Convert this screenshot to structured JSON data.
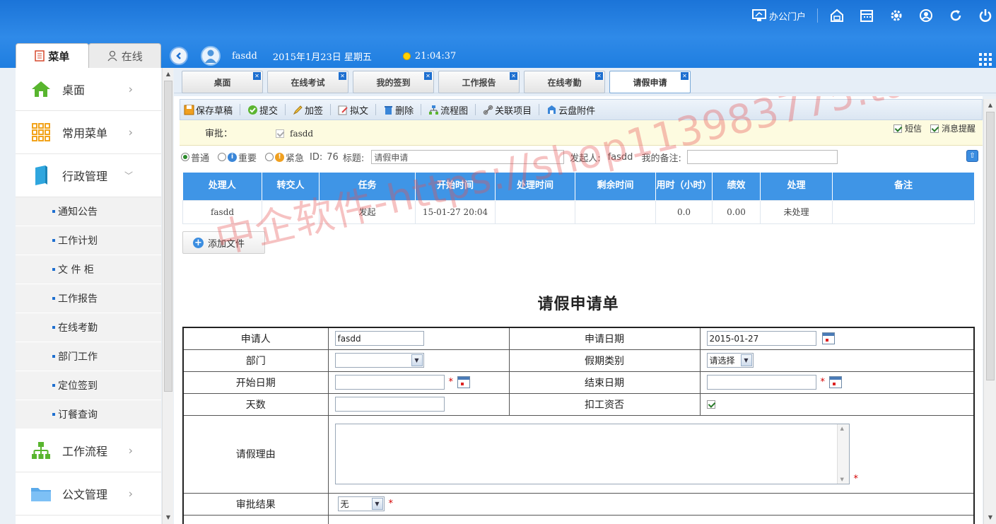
{
  "header": {
    "portal_label": "办公门户",
    "icons": [
      "portal-icon",
      "database-icon",
      "calendar-icon",
      "gear-icon",
      "user-circle-icon",
      "refresh-icon",
      "power-icon"
    ]
  },
  "sidebar_tabs": {
    "menu": "菜单",
    "online": "在线"
  },
  "userbar": {
    "username": "fasdd",
    "date": "2015年1月23日 星期五",
    "time": "21:04:37"
  },
  "sidebar": {
    "items": [
      {
        "label": "桌面",
        "icon": "home-icon"
      },
      {
        "label": "常用菜单",
        "icon": "grid-icon"
      },
      {
        "label": "行政管理",
        "icon": "book-icon"
      }
    ],
    "subitems": [
      "通知公告",
      "工作计划",
      "文 件 柜",
      "工作报告",
      "在线考勤",
      "部门工作",
      "定位签到",
      "订餐查询"
    ],
    "items_after": [
      {
        "label": "工作流程",
        "icon": "flow-icon"
      },
      {
        "label": "公文管理",
        "icon": "folder-icon"
      }
    ]
  },
  "tabs": [
    "桌面",
    "在线考试",
    "我的签到",
    "工作报告",
    "在线考勤",
    "请假申请"
  ],
  "toolbar": {
    "save_draft": "保存草稿",
    "submit": "提交",
    "add_sign": "加签",
    "draft": "拟文",
    "delete": "删除",
    "flowchart": "流程图",
    "related": "关联项目",
    "cloud": "云盘附件"
  },
  "approval": {
    "label": "审批：",
    "person": "fasdd",
    "sms": "短信",
    "msg_remind": "消息提醒"
  },
  "meta": {
    "normal": "普通",
    "important": "重要",
    "urgent": "紧急",
    "id_label": "ID:",
    "id_value": "76",
    "title_label": "标题:",
    "title_value": "请假申请",
    "initiator_label": "发起人:",
    "initiator_value": "fasdd",
    "remark_label": "我的备注:"
  },
  "grid": {
    "headers": [
      "处理人",
      "转交人",
      "任务",
      "开始时间",
      "处理时间",
      "剩余时间",
      "用时（小时）",
      "绩效",
      "处理",
      "备注"
    ],
    "rows": [
      [
        "fasdd",
        "",
        "发起",
        "15-01-27 20:04",
        "",
        "",
        "0.0",
        "0.00",
        "未处理",
        ""
      ]
    ]
  },
  "add_file": "添加文件",
  "form": {
    "title": "请假申请单",
    "applicant_label": "申请人",
    "applicant_value": "fasdd",
    "apply_date_label": "申请日期",
    "apply_date_value": "2015-01-27",
    "dept_label": "部门",
    "leave_type_label": "假期类别",
    "leave_type_value": "请选择",
    "start_label": "开始日期",
    "end_label": "结束日期",
    "days_label": "天数",
    "deduct_label": "扣工资否",
    "reason_label": "请假理由",
    "result_label": "审批结果",
    "result_value": "无",
    "required_mark": "*"
  },
  "watermark": "中企软件-https://shop113983775.taobao.com",
  "colors": {
    "header_blue": "#1f7ee0",
    "grid_header": "#3f95e6",
    "required": "#d40000"
  }
}
